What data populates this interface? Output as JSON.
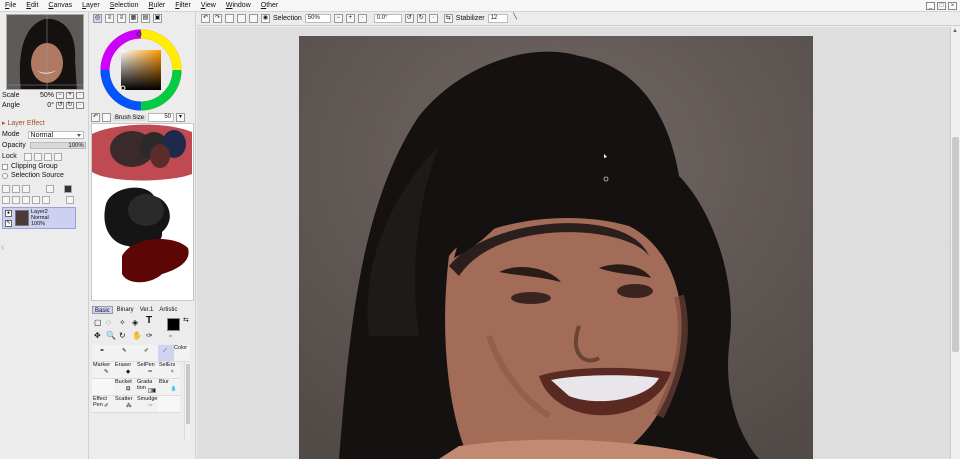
{
  "menu": [
    "File",
    "Edit",
    "Canvas",
    "Layer",
    "Selection",
    "Ruler",
    "Filter",
    "View",
    "Window",
    "Other"
  ],
  "window_controls": [
    "_",
    "□",
    "×"
  ],
  "navigator": {
    "scale_label": "Scale",
    "scale_value": "50%",
    "angle_label": "Angle",
    "angle_value": "0°"
  },
  "layer_effect": {
    "header": "Layer Effect"
  },
  "layer_props": {
    "mode_label": "Mode",
    "mode_value": "Normal",
    "opacity_label": "Opacity",
    "opacity_value": "100%",
    "lock_label": "Lock",
    "clipping_label": "Clipping Group",
    "selection_source_label": "Selection Source"
  },
  "layer": {
    "name": "Layer2",
    "mode": "Normal",
    "opacity": "100%"
  },
  "brush": {
    "size_label": "Brush Size",
    "size_value": "50"
  },
  "tool_tabs": [
    "Basic",
    "Binary",
    "Ver.1",
    "Artistic"
  ],
  "tools": {
    "marker": "Marker",
    "eraser": "Eraser",
    "selpen": "SelPen",
    "selers": "SelErs",
    "bucket": "Bucket",
    "gradation": "Grada tion",
    "blur": "Blur",
    "effect_pen": "Effect Pen",
    "scatter": "Scatter",
    "smudge": "Smudge",
    "color": "Color"
  },
  "toolbar": {
    "selection_label": "Selection",
    "zoom": "50%",
    "rotation": "0.0°",
    "stabilizer_label": "Stabilizer",
    "stabilizer_value": "12"
  },
  "colors": {
    "primary": "#000000",
    "accent": "#cfd4f5"
  }
}
